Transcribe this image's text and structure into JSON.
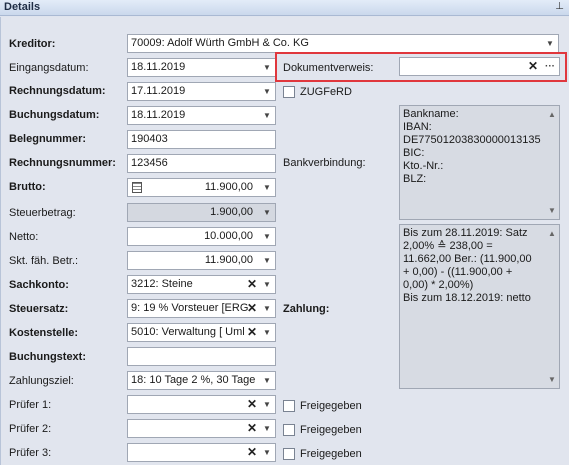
{
  "window": {
    "title": "Details",
    "pin_icon": "pin-icon"
  },
  "labels": {
    "kreditor": "Kreditor:",
    "eingangsdatum": "Eingangsdatum:",
    "rechnungsdatum": "Rechnungsdatum:",
    "buchungsdatum": "Buchungsdatum:",
    "belegnummer": "Belegnummer:",
    "rechnungsnummer": "Rechnungsnummer:",
    "brutto": "Brutto:",
    "steuerbetrag": "Steuerbetrag:",
    "netto": "Netto:",
    "skt": "Skt. fäh. Betr.:",
    "sachkonto": "Sachkonto:",
    "steuersatz": "Steuersatz:",
    "kostenstelle": "Kostenstelle:",
    "buchungstext": "Buchungstext:",
    "zahlungsziel": "Zahlungsziel:",
    "pruefer1": "Prüfer 1:",
    "pruefer2": "Prüfer 2:",
    "pruefer3": "Prüfer 3:",
    "dokumentverweis": "Dokumentverweis:",
    "zugferd": "ZUGFeRD",
    "bankverbindung": "Bankverbindung:",
    "zahlung": "Zahlung:",
    "freigegeben": "Freigegeben"
  },
  "values": {
    "kreditor": "70009: Adolf Würth GmbH & Co. KG",
    "eingangsdatum": "18.11.2019",
    "rechnungsdatum": "17.11.2019",
    "buchungsdatum": "18.11.2019",
    "belegnummer": "190403",
    "rechnungsnummer": "123456",
    "brutto": "11.900,00",
    "steuerbetrag": "1.900,00",
    "netto": "10.000,00",
    "skt": "11.900,00",
    "sachkonto": "3212: Steine",
    "steuersatz": "9: 19 % Vorsteuer [ERG",
    "kostenstelle": "5010: Verwaltung [ Uml",
    "buchungstext": "",
    "zahlungsziel": "18: 10 Tage 2 %, 30 Tage",
    "pruefer1": "",
    "pruefer2": "",
    "pruefer3": "",
    "dokumentverweis": ""
  },
  "bankverbindung_lines": [
    "Bankname:",
    "IBAN:",
    "DE77501203830000013135",
    "BIC:",
    "Kto.-Nr.:",
    "BLZ:"
  ],
  "zahlung_lines": [
    "Bis zum 28.11.2019: Satz",
    "2,00% ≙ 238,00 =",
    "11.662,00 Ber.: (11.900,00",
    "+ 0,00) - ((11.900,00 +",
    "0,00) * 2,00%)",
    "Bis zum 18.12.2019: netto"
  ],
  "glyphs": {
    "dropdown": "▼",
    "clear": "✕",
    "ellipsis": "···",
    "scroll_up": "▲",
    "scroll_down": "▼",
    "pin": "⊥"
  },
  "colors": {
    "highlight": "#e0373d"
  }
}
